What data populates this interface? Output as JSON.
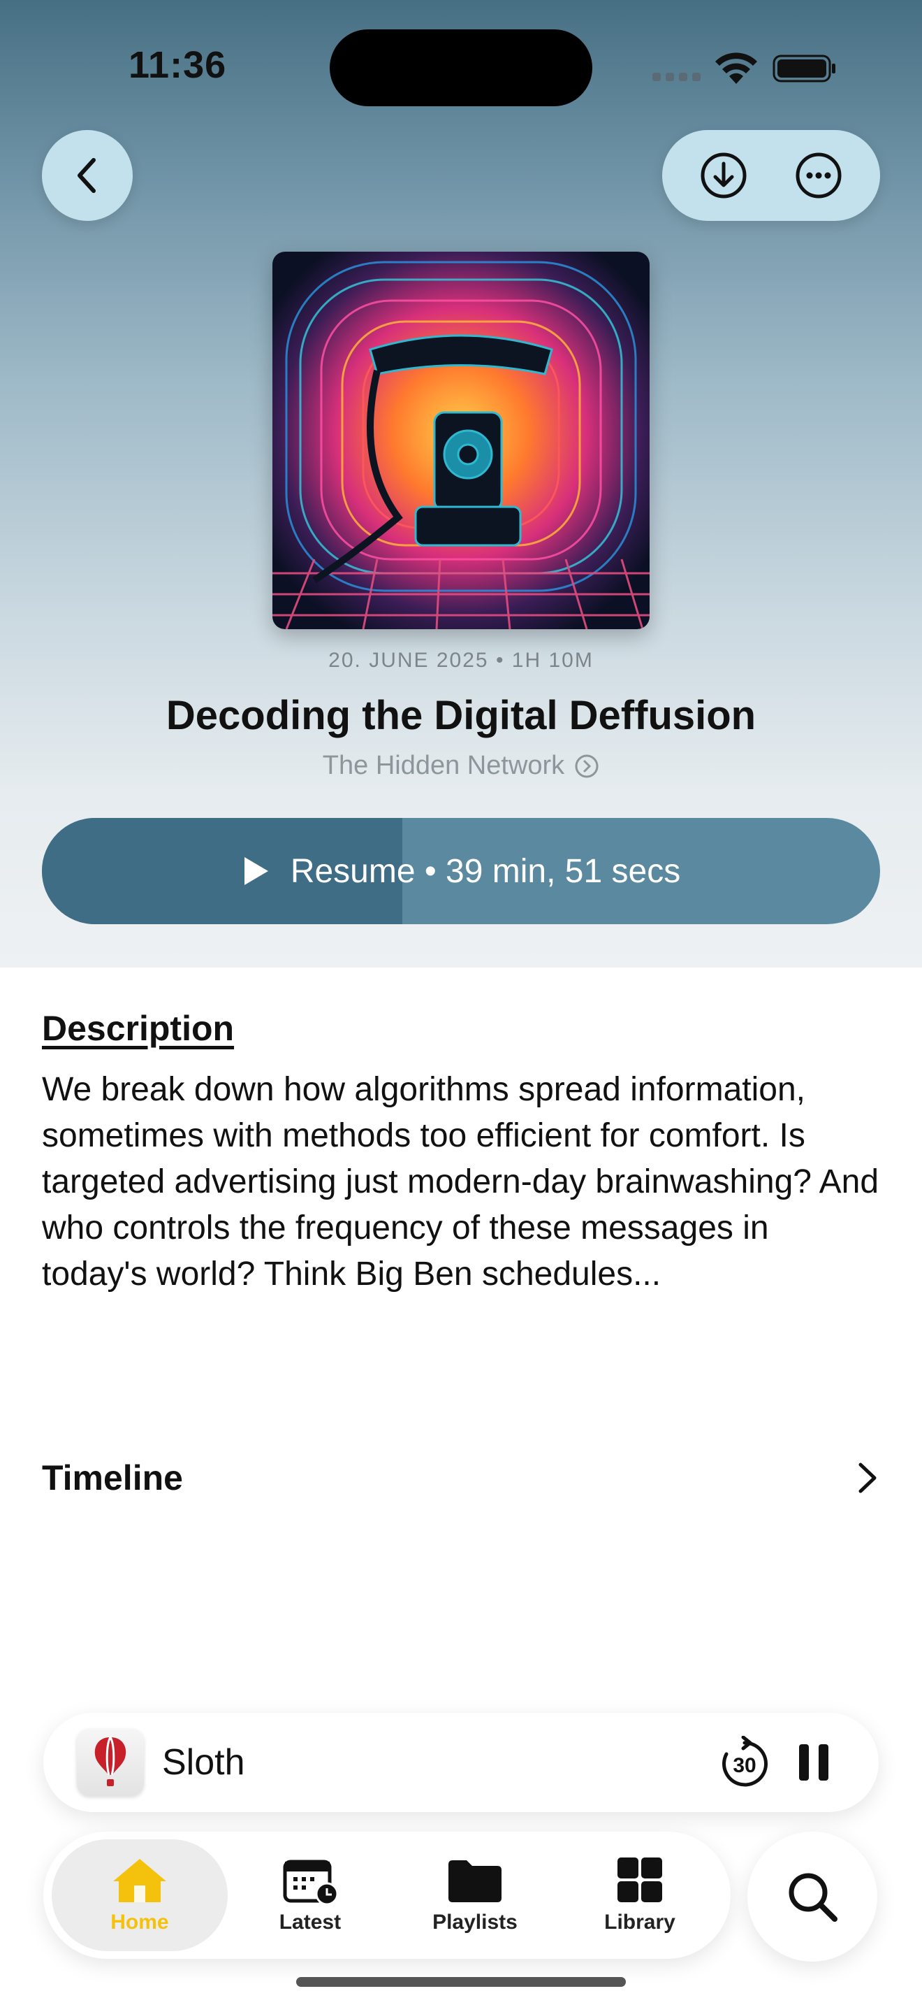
{
  "status_bar": {
    "time": "11:36"
  },
  "episode": {
    "meta": "20. JUNE 2025 • 1H 10M",
    "title": "Decoding the Digital Deffusion",
    "podcast": "The Hidden Network",
    "resume_label": "Resume • 39 min, 51 secs",
    "progress_fraction": 0.43
  },
  "description": {
    "heading": "Description",
    "text": "We break down how algorithms spread information, sometimes with methods too efficient for comfort. Is targeted advertising just modern-day brainwashing? And who controls the frequency of these messages in today's world? Think Big Ben schedules..."
  },
  "timeline": {
    "label": "Timeline"
  },
  "mini_player": {
    "title": "Sloth",
    "skip_label": "30"
  },
  "tabs": [
    {
      "label": "Home",
      "icon": "house-icon"
    },
    {
      "label": "Latest",
      "icon": "calendar-clock-icon"
    },
    {
      "label": "Playlists",
      "icon": "folder-icon"
    },
    {
      "label": "Library",
      "icon": "grid-icon"
    }
  ],
  "colors": {
    "accent": "#f4c20d",
    "resume_bg": "#5b8aa0",
    "resume_progress": "#3f6d85",
    "nav_button_bg": "#c3e1ec"
  }
}
